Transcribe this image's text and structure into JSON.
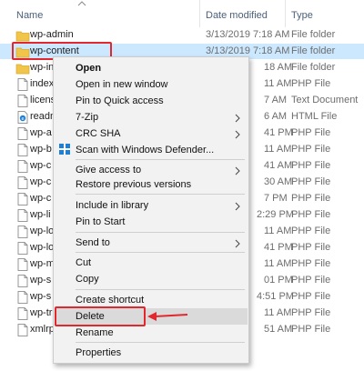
{
  "columns": {
    "name": "Name",
    "date": "Date modified",
    "type": "Type"
  },
  "rows": [
    {
      "icon": "folder-icon",
      "name": "wp-admin",
      "date": "3/13/2019 7:18 AM",
      "type": "File folder"
    },
    {
      "icon": "folder-icon",
      "name": "wp-content",
      "date": "3/13/2019 7:18 AM",
      "type": "File folder",
      "selected": true
    },
    {
      "icon": "folder-icon",
      "name": "wp-in",
      "tail": "18 AM",
      "type": "File folder"
    },
    {
      "icon": "file-icon",
      "name": "index",
      "tail": "11 AM",
      "type": "PHP File"
    },
    {
      "icon": "file-icon",
      "name": "licens",
      "tail": "7 AM",
      "type": "Text Document"
    },
    {
      "icon": "html-file-icon",
      "name": "readm",
      "tail": "6 AM",
      "type": "HTML File"
    },
    {
      "icon": "file-icon",
      "name": "wp-a",
      "tail": "41 PM",
      "type": "PHP File"
    },
    {
      "icon": "file-icon",
      "name": "wp-b",
      "tail": "11 AM",
      "type": "PHP File"
    },
    {
      "icon": "file-icon",
      "name": "wp-c",
      "tail": "41 AM",
      "type": "PHP File"
    },
    {
      "icon": "file-icon",
      "name": "wp-c",
      "tail": "30 AM",
      "type": "PHP File"
    },
    {
      "icon": "file-icon",
      "name": "wp-c",
      "tail": "7 PM",
      "type": "PHP File"
    },
    {
      "icon": "file-icon",
      "name": "wp-li",
      "tail": "2:29 PM",
      "type": "PHP File"
    },
    {
      "icon": "file-icon",
      "name": "wp-lo",
      "tail": "11 AM",
      "type": "PHP File"
    },
    {
      "icon": "file-icon",
      "name": "wp-lo",
      "tail": "41 PM",
      "type": "PHP File"
    },
    {
      "icon": "file-icon",
      "name": "wp-m",
      "tail": "11 AM",
      "type": "PHP File"
    },
    {
      "icon": "file-icon",
      "name": "wp-s",
      "tail": "01 PM",
      "type": "PHP File"
    },
    {
      "icon": "file-icon",
      "name": "wp-s",
      "tail": "4:51 PM",
      "type": "PHP File"
    },
    {
      "icon": "file-icon",
      "name": "wp-tr",
      "tail": "11 AM",
      "type": "PHP File"
    },
    {
      "icon": "file-icon",
      "name": "xmlrp",
      "tail": "51 AM",
      "type": "PHP File"
    }
  ],
  "menu": {
    "open": "Open",
    "open_new_window": "Open in new window",
    "pin_quick_access": "Pin to Quick access",
    "seven_zip": "7-Zip",
    "crc_sha": "CRC SHA",
    "scan_defender": "Scan with Windows Defender...",
    "give_access": "Give access to",
    "restore_versions": "Restore previous versions",
    "include_library": "Include in library",
    "pin_start": "Pin to Start",
    "send_to": "Send to",
    "cut": "Cut",
    "copy": "Copy",
    "create_shortcut": "Create shortcut",
    "delete": "Delete",
    "rename": "Rename",
    "properties": "Properties"
  },
  "colors": {
    "selection": "#cce8ff",
    "annotation_red": "#e0282e",
    "folder": "#f0c54a",
    "defender_blue": "#1e7fd6"
  }
}
